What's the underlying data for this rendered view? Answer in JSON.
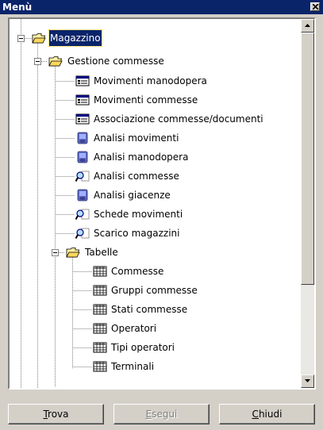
{
  "window": {
    "title": "Menù"
  },
  "tree": [
    {
      "label": "Magazzino",
      "icon": "folder-open-icon",
      "selected": true
    },
    {
      "label": "Gestione commesse",
      "icon": "folder-open-icon"
    },
    {
      "label": "Movimenti manodopera",
      "icon": "form-icon"
    },
    {
      "label": "Movimenti commesse",
      "icon": "form-icon"
    },
    {
      "label": "Associazione commesse/documenti",
      "icon": "form-icon"
    },
    {
      "label": "Analisi movimenti",
      "icon": "analysis-icon"
    },
    {
      "label": "Analisi manodopera",
      "icon": "analysis-icon"
    },
    {
      "label": "Analisi commesse",
      "icon": "report-icon"
    },
    {
      "label": "Analisi giacenze",
      "icon": "analysis-icon"
    },
    {
      "label": "Schede movimenti",
      "icon": "report-icon"
    },
    {
      "label": "Scarico magazzini",
      "icon": "report-icon"
    },
    {
      "label": "Tabelle",
      "icon": "folder-open-icon"
    },
    {
      "label": "Commesse",
      "icon": "table-icon"
    },
    {
      "label": "Gruppi commesse",
      "icon": "table-icon"
    },
    {
      "label": "Stati commesse",
      "icon": "table-icon"
    },
    {
      "label": "Operatori",
      "icon": "table-icon"
    },
    {
      "label": "Tipi operatori",
      "icon": "table-icon"
    },
    {
      "label": "Terminali",
      "icon": "table-icon"
    }
  ],
  "buttons": {
    "trova": {
      "accel": "T",
      "rest": "rova"
    },
    "esegui": {
      "accel": "E",
      "rest": "segui"
    },
    "chiudi": {
      "accel": "C",
      "rest": "hiudi"
    }
  }
}
